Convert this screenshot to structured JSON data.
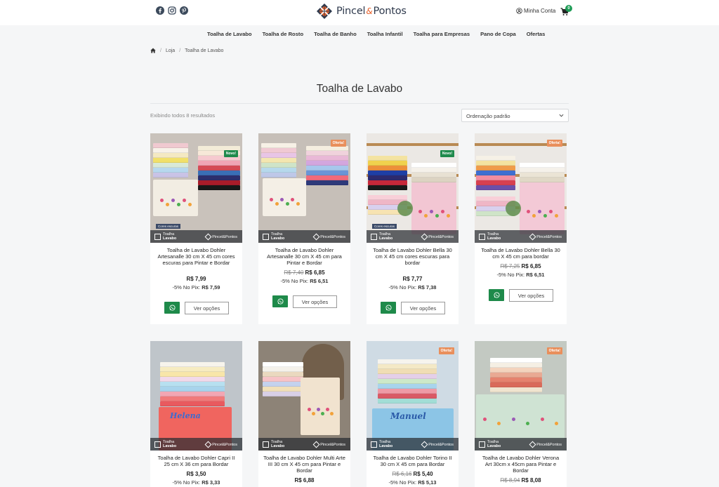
{
  "header": {
    "social": [
      {
        "icon": "facebook-icon"
      },
      {
        "icon": "instagram-icon"
      },
      {
        "icon": "pinterest-icon"
      }
    ],
    "logo": {
      "word1": "Pincel",
      "amp": "&",
      "word2": "Pontos"
    },
    "account_label": "Minha Conta",
    "cart_count": "0",
    "colors": {
      "brand_dark": "#2f3a4d",
      "brand_orange": "#e8622c",
      "accent_green": "#1e9c56"
    }
  },
  "nav": {
    "items": [
      "Toalha de Lavabo",
      "Toalha de Rosto",
      "Toalha de Banho",
      "Toalha Infantil",
      "Toalha para Empresas",
      "Pano de Copa",
      "Ofertas"
    ]
  },
  "breadcrumb": {
    "home_icon": "home-icon",
    "items": [
      "Loja",
      "Toalha de Lavabo"
    ],
    "separator": "/"
  },
  "page": {
    "title": "Toalha de Lavabo",
    "result_count": "Exibindo todos 8 resultados",
    "sort_selected": "Ordenação padrão"
  },
  "image_overlay": {
    "brand_line1": "Toalha",
    "brand_line2": "Lavabo",
    "logo_text": "Pincel&Pontos",
    "cores_label": "Cores escuras"
  },
  "products": [
    {
      "name": "Toalha de Lavabo Dohler Artesanalle 30 cm X 45 cm cores escuras para Pintar e Bordar",
      "badge": "Novo!",
      "old_price": "",
      "price": "R$ 7,99",
      "pix_label": "-5% No Pix:",
      "pix_price": "R$ 7,59",
      "button": "Ver opções"
    },
    {
      "name": "Toalha de Lavabo Dohler Artesanalle 30 cm X 45 cm para Pintar e Bordar",
      "badge": "Oferta!",
      "old_price": "R$ 7,40",
      "price": "R$ 6,85",
      "pix_label": "-5% No Pix:",
      "pix_price": "R$ 6,51",
      "button": "Ver opções"
    },
    {
      "name": "Toalha de Lavabo Dohler Bella 30 cm X 45 cm cores escuras para bordar",
      "badge": "Novo!",
      "old_price": "",
      "price": "R$ 7,77",
      "pix_label": "-5% No Pix:",
      "pix_price": "R$ 7,38",
      "button": "Ver opções"
    },
    {
      "name": "Toalha de Lavabo Dohler Bella 30 cm X 45 cm para bordar",
      "badge": "Oferta!",
      "old_price": "R$ 7,25",
      "price": "R$ 6,85",
      "pix_label": "-5% No Pix:",
      "pix_price": "R$ 6,51",
      "button": "Ver opções"
    },
    {
      "name": "Toalha de Lavabo Dohler Capri II 25 cm X 36 cm para Bordar",
      "badge": "",
      "old_price": "",
      "price": "R$ 3,50",
      "pix_label": "-5% No Pix:",
      "pix_price": "R$ 3,33",
      "embroidery": "Helena"
    },
    {
      "name": "Toalha de Lavabo Dohler Multi Arte III 30 cm X 45 cm para Pintar e Bordar",
      "badge": "",
      "old_price": "",
      "price": "R$ 6,88",
      "pix_label": "",
      "pix_price": ""
    },
    {
      "name": "Toalha de Lavabo Dohler Torino II 30 cm X 45 cm para Bordar",
      "badge": "Oferta!",
      "old_price": "R$ 6,16",
      "price": "R$ 5,40",
      "pix_label": "-5% No Pix:",
      "pix_price": "R$ 5,13",
      "embroidery": "Manuel"
    },
    {
      "name": "Toalha de Lavabo Dohler Verona Art 30cm x 45cm para Pintar e Bordar",
      "badge": "Oferta!",
      "old_price": "R$ 8,94",
      "price": "R$ 8,08",
      "pix_label": "",
      "pix_price": ""
    }
  ]
}
